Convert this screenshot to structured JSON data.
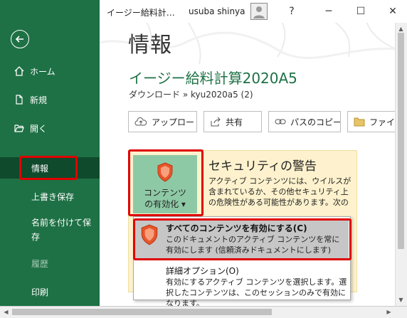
{
  "window": {
    "doc_title": "イージー給料計…",
    "user": "usuba shinya",
    "help": "?",
    "min": "─",
    "max": "☐",
    "close": "✕"
  },
  "sidebar": {
    "items": [
      {
        "label": "ホーム"
      },
      {
        "label": "新規"
      },
      {
        "label": "開く"
      },
      {
        "label": "情報"
      },
      {
        "label": "上書き保存"
      },
      {
        "label": "名前を付けて保"
      },
      {
        "label": "存"
      },
      {
        "label": "履歴"
      },
      {
        "label": "印刷"
      }
    ]
  },
  "main": {
    "page_title": "情報",
    "doc_name": "イージー給料計算2020A5",
    "breadcrumb": "ダウンロード » kyu2020a5 (2)",
    "actions": [
      {
        "label": "アップロード"
      },
      {
        "label": "共有"
      },
      {
        "label": "パスのコピー"
      },
      {
        "label": "ファイル"
      }
    ]
  },
  "security": {
    "enable_line1": "コンテンツ",
    "enable_line2": "の有効化 ▾",
    "title": "セキュリティの警告",
    "desc": "アクティブ コンテンツには、ウイルスが含まれているか、その他セキュリティ上の危険性がある可能性があります。次のコンテンツが無効になっています:"
  },
  "dropdown": {
    "item1_title": "すべてのコンテンツを有効にする(C)",
    "item1_desc": "このドキュメントのアクティブ コンテンツを常に有効にします (信頼済みドキュメントにします)",
    "item2_title": "詳細オプション(O)",
    "item2_desc": "有効にするアクティブ コンテンツを選択します。選択したコンテンツは、このセッションのみで有効になります。"
  },
  "colors": {
    "sidebar": "#1e7145",
    "accent": "#1e7145",
    "highlight": "#e00000",
    "panel": "#fdf2cd"
  }
}
